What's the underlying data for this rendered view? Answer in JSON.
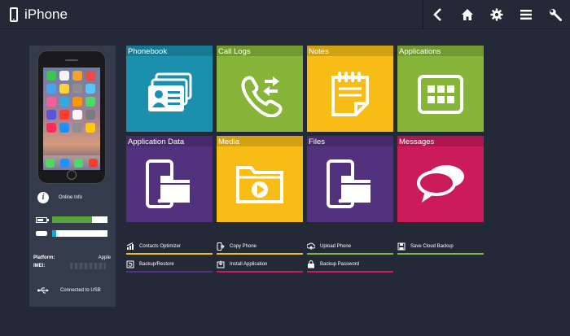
{
  "header": {
    "title": "iPhone",
    "toolbar": [
      "back-icon",
      "home-icon",
      "gear-icon",
      "menu-icon",
      "wrench-icon"
    ]
  },
  "device": {
    "online_info_label": "Online Info",
    "battery_level": 0.72,
    "storage_used": 0.08,
    "platform_label": "Platform:",
    "platform_value": "Apple",
    "imei_label": "IMEI:",
    "connection_label": "Connected to USB"
  },
  "colors": {
    "teal": "#1b8fae",
    "green": "#86b53a",
    "yellow": "#f7bd16",
    "purple": "#52317e",
    "pink": "#cc1b5b",
    "battery_green": "#5aa33a",
    "storage_blue": "#1aa7c8"
  },
  "tiles": [
    {
      "label": "Phonebook",
      "icon": "contacts-cards-icon",
      "color": "#1b8fae"
    },
    {
      "label": "Call Logs",
      "icon": "call-logs-icon",
      "color": "#86b53a"
    },
    {
      "label": "Notes",
      "icon": "notepad-icon",
      "color": "#f7bd16"
    },
    {
      "label": "Applications",
      "icon": "app-grid-icon",
      "color": "#86b53a"
    },
    {
      "label": "Application Data",
      "icon": "phone-folder-icon",
      "color": "#52317e"
    },
    {
      "label": "Media",
      "icon": "media-folder-icon",
      "color": "#f7bd16"
    },
    {
      "label": "Files",
      "icon": "phone-folder-icon",
      "color": "#52317e"
    },
    {
      "label": "Messages",
      "icon": "chat-bubbles-icon",
      "color": "#cc1b5b"
    }
  ],
  "actions": [
    {
      "label": "Contacts Optimizer",
      "icon": "optimizer-icon",
      "color": "#f7bd16"
    },
    {
      "label": "Copy Phone",
      "icon": "copy-phone-icon",
      "color": "#f7bd16"
    },
    {
      "label": "Upload Phone",
      "icon": "upload-phone-icon",
      "color": "#86b53a"
    },
    {
      "label": "Save Cloud Backup",
      "icon": "cloud-backup-icon",
      "color": "#86b53a"
    },
    {
      "label": "Backup/Restore",
      "icon": "backup-restore-icon",
      "color": "#52317e"
    },
    {
      "label": "Install Application",
      "icon": "install-app-icon",
      "color": "#cc1b5b"
    },
    {
      "label": "Backup Password",
      "icon": "backup-password-icon",
      "color": "#cc1b5b"
    }
  ]
}
